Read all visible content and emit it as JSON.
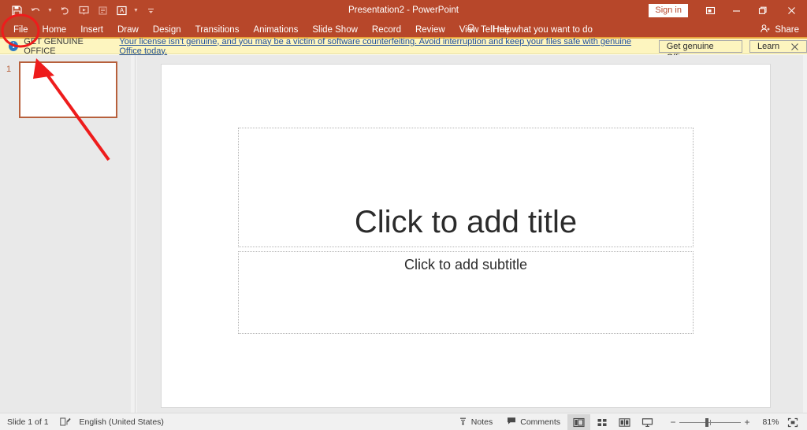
{
  "window": {
    "title": "Presentation2  -  PowerPoint",
    "signin_label": "Sign in",
    "ribbon_display_icon": "ribbon-display-options-icon",
    "minimize_icon": "minimize-icon",
    "restore_icon": "restore-icon",
    "close_icon": "close-icon"
  },
  "quick_access": {
    "items": [
      {
        "name": "save-icon",
        "title": "Save"
      },
      {
        "name": "undo-icon",
        "title": "Undo"
      },
      {
        "name": "undo-dropdown-caret-icon",
        "title": "Undo options"
      },
      {
        "name": "redo-icon",
        "title": "Redo"
      },
      {
        "name": "start-from-beginning-icon",
        "title": "Start From Beginning"
      },
      {
        "name": "present-online-icon",
        "title": "Present"
      },
      {
        "name": "text-format-icon",
        "title": "Text"
      },
      {
        "name": "text-dropdown-caret-icon",
        "title": "Text options"
      },
      {
        "name": "customize-quick-access-toolbar-icon",
        "title": "Customize Quick Access Toolbar"
      }
    ]
  },
  "ribbon": {
    "tabs": [
      {
        "label": "File",
        "active": true
      },
      {
        "label": "Home",
        "active": false
      },
      {
        "label": "Insert",
        "active": false
      },
      {
        "label": "Draw",
        "active": false
      },
      {
        "label": "Design",
        "active": false
      },
      {
        "label": "Transitions",
        "active": false
      },
      {
        "label": "Animations",
        "active": false
      },
      {
        "label": "Slide Show",
        "active": false
      },
      {
        "label": "Record",
        "active": false
      },
      {
        "label": "Review",
        "active": false
      },
      {
        "label": "View",
        "active": false
      },
      {
        "label": "Help",
        "active": false
      }
    ],
    "tell_me": "Tell me what you want to do",
    "tell_me_icon": "lightbulb-icon",
    "share_label": "Share",
    "share_icon": "share-person-icon",
    "accent_color": "#e8a33d",
    "background_color": "#b7472a"
  },
  "banner": {
    "icon": "info-icon",
    "icon_glyph": "i",
    "label": "GET GENUINE OFFICE",
    "message": "Your license isn't genuine, and you may be a victim of software counterfeiting. Avoid interruption and keep your files safe with genuine Office today.",
    "primary_button": "Get genuine Office",
    "secondary_button": "Learn more",
    "close_icon": "close-icon",
    "background_color": "#fdf5bf"
  },
  "thumbnails": {
    "slides": [
      {
        "number": "1",
        "selected": true
      }
    ]
  },
  "slide": {
    "title_placeholder": "Click to add title",
    "subtitle_placeholder": "Click to add subtitle"
  },
  "status_bar": {
    "slide_count": "Slide 1 of 1",
    "accessibility_icon": "accessibility-checker-icon",
    "language": "English (United States)",
    "notes_label": "Notes",
    "notes_icon": "notes-icon",
    "comments_label": "Comments",
    "comments_icon": "comments-icon",
    "views": [
      {
        "name": "normal-view-button",
        "active": true
      },
      {
        "name": "slide-sorter-view-button",
        "active": false
      },
      {
        "name": "reading-view-button",
        "active": false
      },
      {
        "name": "slide-show-view-button",
        "active": false
      }
    ],
    "zoom_out_icon": "zoom-out-icon",
    "zoom_in_icon": "zoom-in-icon",
    "zoom_level": "81%",
    "fit_slide_icon": "fit-slide-to-window-icon"
  },
  "annotations": {
    "circle_target": "file-tab",
    "arrow_target": "slide-thumbnail-1",
    "color": "#ee1c1c"
  }
}
